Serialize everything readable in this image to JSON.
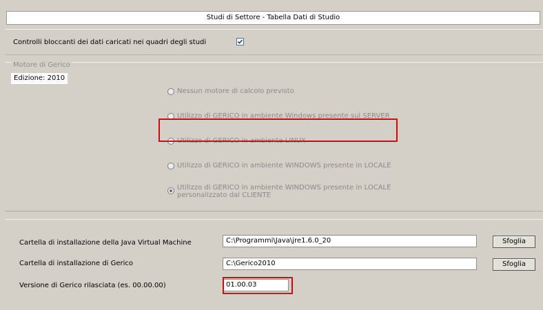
{
  "title": "Studi di Settore - Tabella Dati di Studio",
  "blocking_checks": {
    "label": "Controlli bloccanti dei dati caricati nei quadri degli studi",
    "checked": true
  },
  "engine": {
    "legend": "Motore di Gerico",
    "edition": "Edizione: 2010",
    "options": [
      {
        "label": "Nessun motore di calcolo previsto",
        "selected": false
      },
      {
        "label": "Utilizzo di GERICO in ambiente Windows presente sul SERVER",
        "selected": false
      },
      {
        "label": "Utilizzo di GERICO in ambiente LINUX",
        "selected": false
      },
      {
        "label": "Utilizzo di GERICO in ambiente WINDOWS presente in LOCALE",
        "selected": false
      },
      {
        "label_line1": "Utilizzo di GERICO in ambiente WINDOWS presente in LOCALE",
        "label_line2": "personalizzato dal CLIENTE",
        "selected": true
      }
    ]
  },
  "paths": {
    "jvm_label": "Cartella di installazione della Java Virtual Machine",
    "jvm_value": "C:\\Programmi\\Java\\jre1.6.0_20",
    "gerico_label": "Cartella di installazione di Gerico",
    "gerico_value": "C:\\Gerico2010",
    "version_label": "Versione di Gerico rilasciata (es. 00.00.00)",
    "version_value": "01.00.03",
    "browse_label": "Sfoglia"
  },
  "colors": {
    "background": "#d4d0c8",
    "highlight": "#e00000"
  }
}
